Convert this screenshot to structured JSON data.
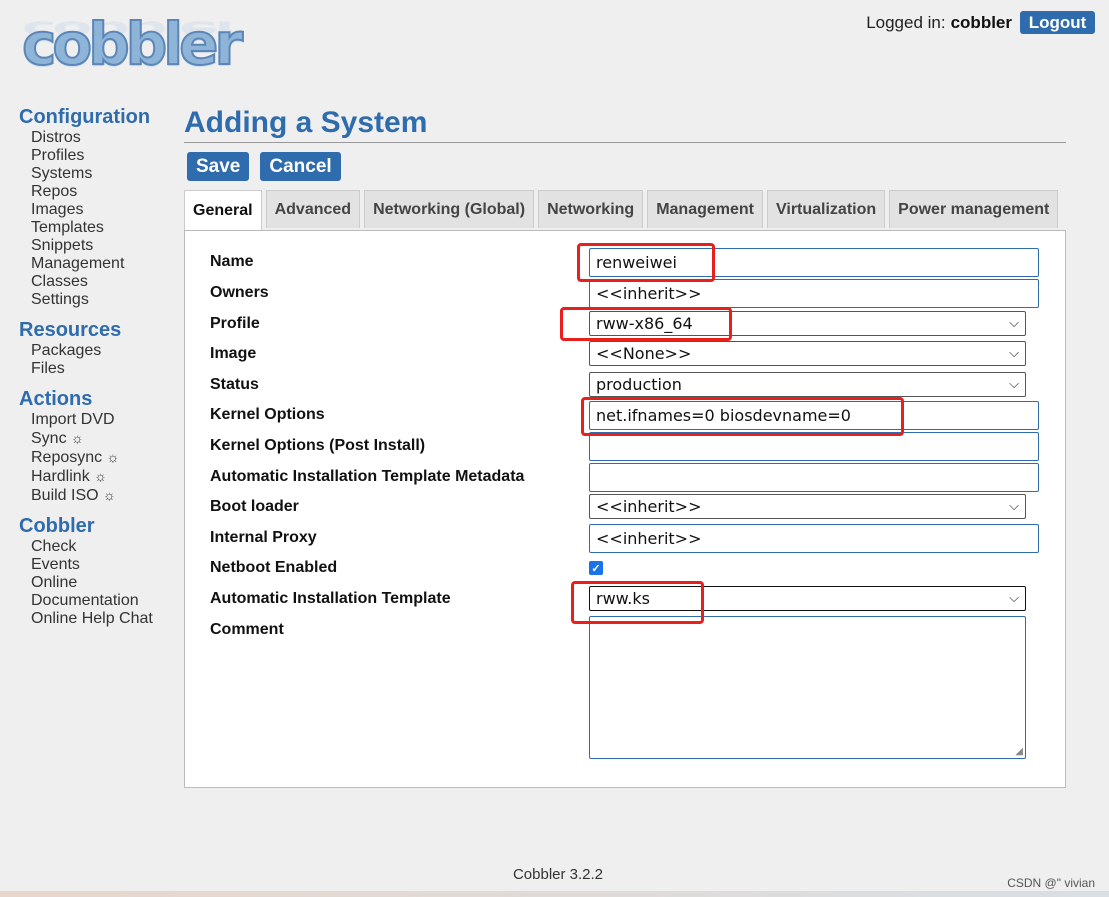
{
  "header": {
    "logo_text": "cobbler",
    "logged_in_label": "Logged in:",
    "username": "cobbler",
    "logout_label": "Logout"
  },
  "sidebar": {
    "configuration": {
      "title": "Configuration",
      "items": [
        "Distros",
        "Profiles",
        "Systems",
        "Repos",
        "Images",
        "Templates",
        "Snippets",
        "Management",
        "Classes",
        "Settings"
      ]
    },
    "resources": {
      "title": "Resources",
      "items": [
        "Packages",
        "Files"
      ]
    },
    "actions": {
      "title": "Actions",
      "items": [
        "Import DVD",
        "Sync",
        "Reposync",
        "Hardlink",
        "Build ISO"
      ],
      "gear": "☼"
    },
    "cobbler": {
      "title": "Cobbler",
      "items": [
        "Check",
        "Events",
        "Online",
        "Documentation",
        "Online Help Chat"
      ]
    }
  },
  "main": {
    "title": "Adding a System",
    "save_label": "Save",
    "cancel_label": "Cancel",
    "tabs": [
      "General",
      "Advanced",
      "Networking (Global)",
      "Networking",
      "Management",
      "Virtualization",
      "Power management"
    ],
    "active_tab": "General",
    "fields": {
      "name": {
        "label": "Name",
        "value": "renweiwei"
      },
      "owners": {
        "label": "Owners",
        "value": "<<inherit>>"
      },
      "profile": {
        "label": "Profile",
        "value": "rww-x86_64"
      },
      "image": {
        "label": "Image",
        "value": "<<None>>"
      },
      "status": {
        "label": "Status",
        "value": "production"
      },
      "kernel_options": {
        "label": "Kernel Options",
        "value": "net.ifnames=0 biosdevname=0"
      },
      "kernel_options_post": {
        "label": "Kernel Options (Post Install)",
        "value": ""
      },
      "autoinstall_meta": {
        "label": "Automatic Installation Template Metadata",
        "value": ""
      },
      "boot_loader": {
        "label": "Boot loader",
        "value": "<<inherit>>"
      },
      "internal_proxy": {
        "label": "Internal Proxy",
        "value": "<<inherit>>"
      },
      "netboot_enabled": {
        "label": "Netboot Enabled",
        "checked": true
      },
      "autoinstall": {
        "label": "Automatic Installation Template",
        "value": "rww.ks"
      },
      "comment": {
        "label": "Comment",
        "value": ""
      }
    }
  },
  "footer": {
    "version": "Cobbler 3.2.2",
    "watermark": "CSDN @\" vivian"
  },
  "colors": {
    "accent": "#2f6cad",
    "highlight": "#e8201c",
    "background": "#efefef"
  }
}
